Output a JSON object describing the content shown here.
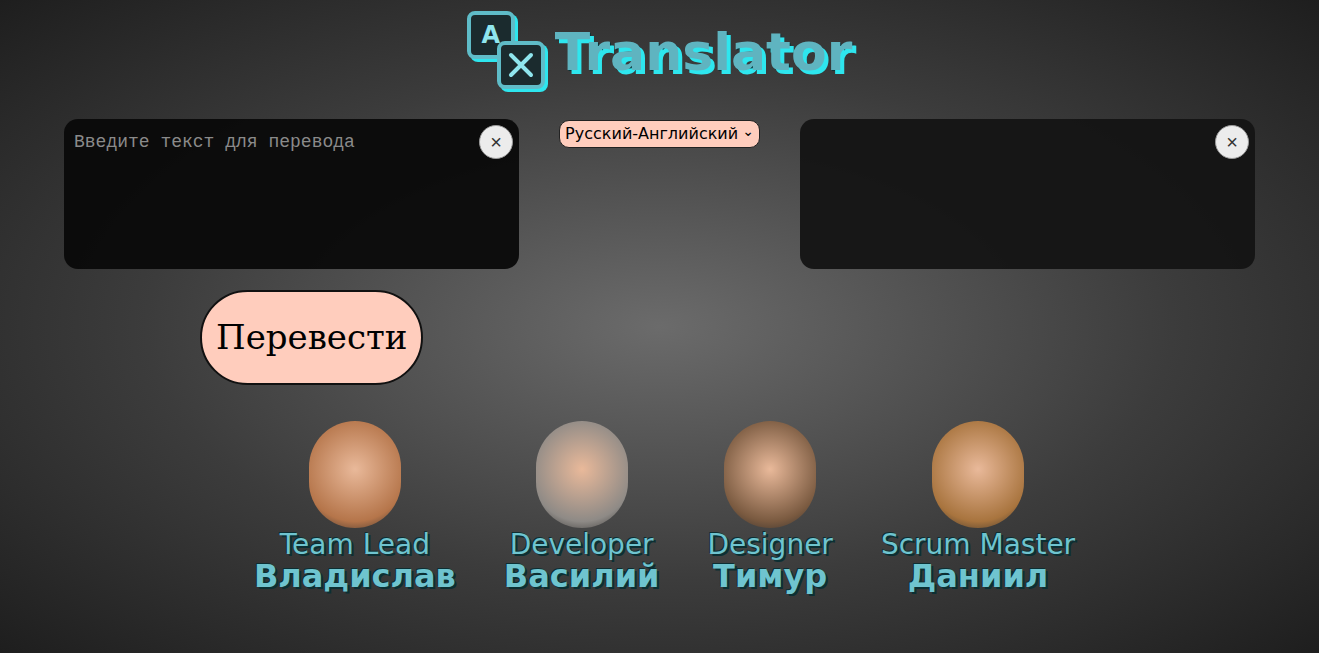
{
  "logo": {
    "icon_letter": "A",
    "text": "Translator"
  },
  "source": {
    "placeholder": "Введите текст для перевода",
    "clear": "×"
  },
  "language": {
    "value": "Русский-Английский",
    "arrow": "⌄"
  },
  "target": {
    "clear": "×"
  },
  "translate_button": {
    "label": "Перевести"
  },
  "team": [
    {
      "role": "Team Lead",
      "name": "Владислав"
    },
    {
      "role": "Developer",
      "name": "Василий"
    },
    {
      "role": "Designer",
      "name": "Тимур"
    },
    {
      "role": "Scrum Master",
      "name": "Даниил"
    }
  ]
}
